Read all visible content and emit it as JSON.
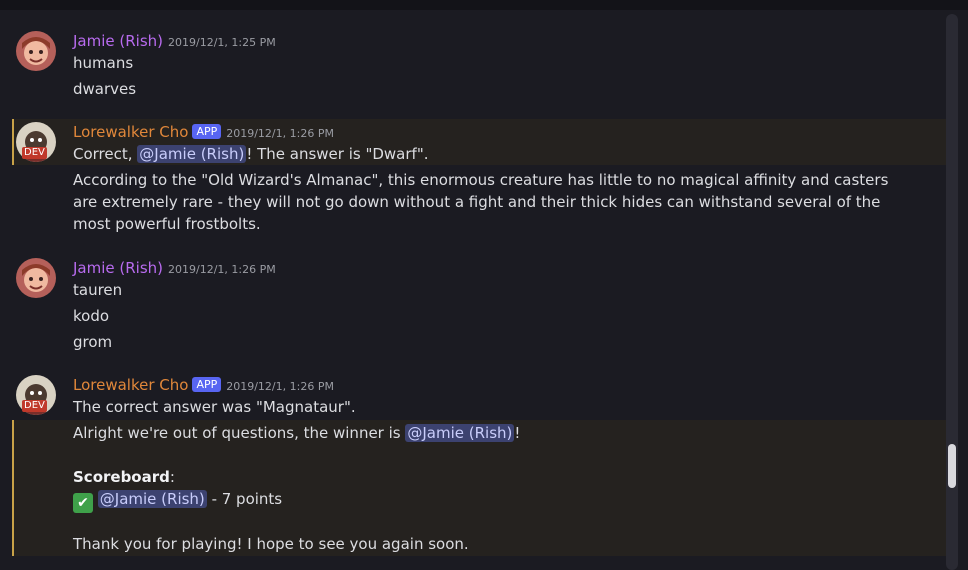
{
  "messages": [
    {
      "author": "Jamie (Rish)",
      "timestamp": "2019/12/1, 1:25 PM",
      "lines": [
        "humans",
        "dwarves"
      ]
    },
    {
      "author": "Lorewalker Cho",
      "badge": "APP",
      "avatar_badge": "DEV",
      "timestamp": "2019/12/1, 1:26 PM",
      "line1_prefix": "Correct, ",
      "mention": "@Jamie (Rish)",
      "line1_suffix": "! The answer is \"Dwarf\".",
      "paragraph": "According to the \"Old Wizard's Almanac\", this enormous creature has little to no magical affinity and casters are extremely rare - they will not go down without a fight and their thick hides can withstand several of the most powerful frostbolts."
    },
    {
      "author": "Jamie (Rish)",
      "timestamp": "2019/12/1, 1:26 PM",
      "lines": [
        "tauren",
        "kodo",
        "grom"
      ]
    },
    {
      "author": "Lorewalker Cho",
      "badge": "APP",
      "avatar_badge": "DEV",
      "timestamp": "2019/12/1, 1:26 PM",
      "line1": "The correct answer was \"Magnataur\".",
      "winner_prefix": "Alright we're out of questions, the winner is ",
      "winner_mention": "@Jamie (Rish)",
      "winner_suffix": "!",
      "scoreboard_label": "Scoreboard",
      "scoreboard_colon": ":",
      "score_icon": "white-check-mark-emoji",
      "score_mention": "@Jamie (Rish)",
      "score_text": " - 7 points",
      "closing": "Thank you for playing! I hope to see you again soon."
    }
  ],
  "colors": {
    "jamie_name": "#b86bef",
    "lore_name": "#e0873a",
    "app_badge": "#5865f2",
    "highlight_border": "#c8a248",
    "mention_bg": "#3c4270"
  }
}
